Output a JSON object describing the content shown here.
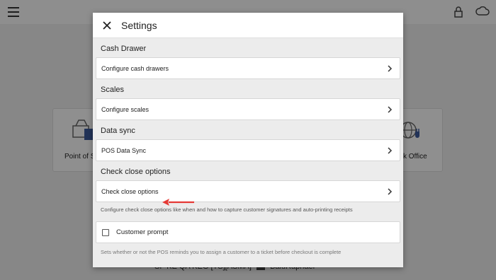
{
  "background": {
    "cards": [
      {
        "label": "Point of S",
        "icon": "pos-terminal-icon"
      },
      {
        "label": "ck Office",
        "icon": "globe-plug-icon"
      }
    ],
    "bottom_text_left": "SF KE QA KEG [TS][ASMA]",
    "bottom_text_right": "BaluRaphael"
  },
  "dialog": {
    "title": "Settings",
    "sections": [
      {
        "heading": "Cash Drawer",
        "row_label": "Configure cash drawers"
      },
      {
        "heading": "Scales",
        "row_label": "Configure scales"
      },
      {
        "heading": "Data sync",
        "row_label": "POS Data Sync"
      },
      {
        "heading": "Check close options",
        "row_label": "Check close options"
      }
    ],
    "check_close_help": "Configure check close options like when and how to capture customer signatures and auto-printing receipts",
    "customer_prompt_label": "Customer prompt",
    "customer_prompt_help": "Sets whether or not the POS reminds you to assign a customer to a ticket before checkout is complete"
  },
  "colors": {
    "annotation_arrow": "#e53935"
  }
}
